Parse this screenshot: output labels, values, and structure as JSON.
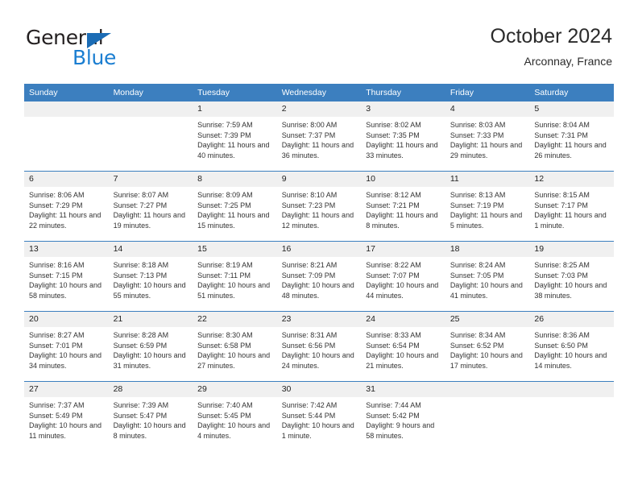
{
  "brand": {
    "name_top": "General",
    "name_bottom": "Blue",
    "triangle_color": "#1b6cb5",
    "blue_color": "#1b7ed1"
  },
  "header": {
    "title": "October 2024",
    "subtitle": "Arconnay, France"
  },
  "theme": {
    "header_bg": "#3c7fbf",
    "daynum_bg": "#f0f0f0",
    "rule_color": "#3c7fbf"
  },
  "weekdays": [
    "Sunday",
    "Monday",
    "Tuesday",
    "Wednesday",
    "Thursday",
    "Friday",
    "Saturday"
  ],
  "weeks": [
    [
      {
        "day": "",
        "sunrise": "",
        "sunset": "",
        "daylight": ""
      },
      {
        "day": "",
        "sunrise": "",
        "sunset": "",
        "daylight": ""
      },
      {
        "day": "1",
        "sunrise": "Sunrise: 7:59 AM",
        "sunset": "Sunset: 7:39 PM",
        "daylight": "Daylight: 11 hours and 40 minutes."
      },
      {
        "day": "2",
        "sunrise": "Sunrise: 8:00 AM",
        "sunset": "Sunset: 7:37 PM",
        "daylight": "Daylight: 11 hours and 36 minutes."
      },
      {
        "day": "3",
        "sunrise": "Sunrise: 8:02 AM",
        "sunset": "Sunset: 7:35 PM",
        "daylight": "Daylight: 11 hours and 33 minutes."
      },
      {
        "day": "4",
        "sunrise": "Sunrise: 8:03 AM",
        "sunset": "Sunset: 7:33 PM",
        "daylight": "Daylight: 11 hours and 29 minutes."
      },
      {
        "day": "5",
        "sunrise": "Sunrise: 8:04 AM",
        "sunset": "Sunset: 7:31 PM",
        "daylight": "Daylight: 11 hours and 26 minutes."
      }
    ],
    [
      {
        "day": "6",
        "sunrise": "Sunrise: 8:06 AM",
        "sunset": "Sunset: 7:29 PM",
        "daylight": "Daylight: 11 hours and 22 minutes."
      },
      {
        "day": "7",
        "sunrise": "Sunrise: 8:07 AM",
        "sunset": "Sunset: 7:27 PM",
        "daylight": "Daylight: 11 hours and 19 minutes."
      },
      {
        "day": "8",
        "sunrise": "Sunrise: 8:09 AM",
        "sunset": "Sunset: 7:25 PM",
        "daylight": "Daylight: 11 hours and 15 minutes."
      },
      {
        "day": "9",
        "sunrise": "Sunrise: 8:10 AM",
        "sunset": "Sunset: 7:23 PM",
        "daylight": "Daylight: 11 hours and 12 minutes."
      },
      {
        "day": "10",
        "sunrise": "Sunrise: 8:12 AM",
        "sunset": "Sunset: 7:21 PM",
        "daylight": "Daylight: 11 hours and 8 minutes."
      },
      {
        "day": "11",
        "sunrise": "Sunrise: 8:13 AM",
        "sunset": "Sunset: 7:19 PM",
        "daylight": "Daylight: 11 hours and 5 minutes."
      },
      {
        "day": "12",
        "sunrise": "Sunrise: 8:15 AM",
        "sunset": "Sunset: 7:17 PM",
        "daylight": "Daylight: 11 hours and 1 minute."
      }
    ],
    [
      {
        "day": "13",
        "sunrise": "Sunrise: 8:16 AM",
        "sunset": "Sunset: 7:15 PM",
        "daylight": "Daylight: 10 hours and 58 minutes."
      },
      {
        "day": "14",
        "sunrise": "Sunrise: 8:18 AM",
        "sunset": "Sunset: 7:13 PM",
        "daylight": "Daylight: 10 hours and 55 minutes."
      },
      {
        "day": "15",
        "sunrise": "Sunrise: 8:19 AM",
        "sunset": "Sunset: 7:11 PM",
        "daylight": "Daylight: 10 hours and 51 minutes."
      },
      {
        "day": "16",
        "sunrise": "Sunrise: 8:21 AM",
        "sunset": "Sunset: 7:09 PM",
        "daylight": "Daylight: 10 hours and 48 minutes."
      },
      {
        "day": "17",
        "sunrise": "Sunrise: 8:22 AM",
        "sunset": "Sunset: 7:07 PM",
        "daylight": "Daylight: 10 hours and 44 minutes."
      },
      {
        "day": "18",
        "sunrise": "Sunrise: 8:24 AM",
        "sunset": "Sunset: 7:05 PM",
        "daylight": "Daylight: 10 hours and 41 minutes."
      },
      {
        "day": "19",
        "sunrise": "Sunrise: 8:25 AM",
        "sunset": "Sunset: 7:03 PM",
        "daylight": "Daylight: 10 hours and 38 minutes."
      }
    ],
    [
      {
        "day": "20",
        "sunrise": "Sunrise: 8:27 AM",
        "sunset": "Sunset: 7:01 PM",
        "daylight": "Daylight: 10 hours and 34 minutes."
      },
      {
        "day": "21",
        "sunrise": "Sunrise: 8:28 AM",
        "sunset": "Sunset: 6:59 PM",
        "daylight": "Daylight: 10 hours and 31 minutes."
      },
      {
        "day": "22",
        "sunrise": "Sunrise: 8:30 AM",
        "sunset": "Sunset: 6:58 PM",
        "daylight": "Daylight: 10 hours and 27 minutes."
      },
      {
        "day": "23",
        "sunrise": "Sunrise: 8:31 AM",
        "sunset": "Sunset: 6:56 PM",
        "daylight": "Daylight: 10 hours and 24 minutes."
      },
      {
        "day": "24",
        "sunrise": "Sunrise: 8:33 AM",
        "sunset": "Sunset: 6:54 PM",
        "daylight": "Daylight: 10 hours and 21 minutes."
      },
      {
        "day": "25",
        "sunrise": "Sunrise: 8:34 AM",
        "sunset": "Sunset: 6:52 PM",
        "daylight": "Daylight: 10 hours and 17 minutes."
      },
      {
        "day": "26",
        "sunrise": "Sunrise: 8:36 AM",
        "sunset": "Sunset: 6:50 PM",
        "daylight": "Daylight: 10 hours and 14 minutes."
      }
    ],
    [
      {
        "day": "27",
        "sunrise": "Sunrise: 7:37 AM",
        "sunset": "Sunset: 5:49 PM",
        "daylight": "Daylight: 10 hours and 11 minutes."
      },
      {
        "day": "28",
        "sunrise": "Sunrise: 7:39 AM",
        "sunset": "Sunset: 5:47 PM",
        "daylight": "Daylight: 10 hours and 8 minutes."
      },
      {
        "day": "29",
        "sunrise": "Sunrise: 7:40 AM",
        "sunset": "Sunset: 5:45 PM",
        "daylight": "Daylight: 10 hours and 4 minutes."
      },
      {
        "day": "30",
        "sunrise": "Sunrise: 7:42 AM",
        "sunset": "Sunset: 5:44 PM",
        "daylight": "Daylight: 10 hours and 1 minute."
      },
      {
        "day": "31",
        "sunrise": "Sunrise: 7:44 AM",
        "sunset": "Sunset: 5:42 PM",
        "daylight": "Daylight: 9 hours and 58 minutes."
      },
      {
        "day": "",
        "sunrise": "",
        "sunset": "",
        "daylight": ""
      },
      {
        "day": "",
        "sunrise": "",
        "sunset": "",
        "daylight": ""
      }
    ]
  ]
}
